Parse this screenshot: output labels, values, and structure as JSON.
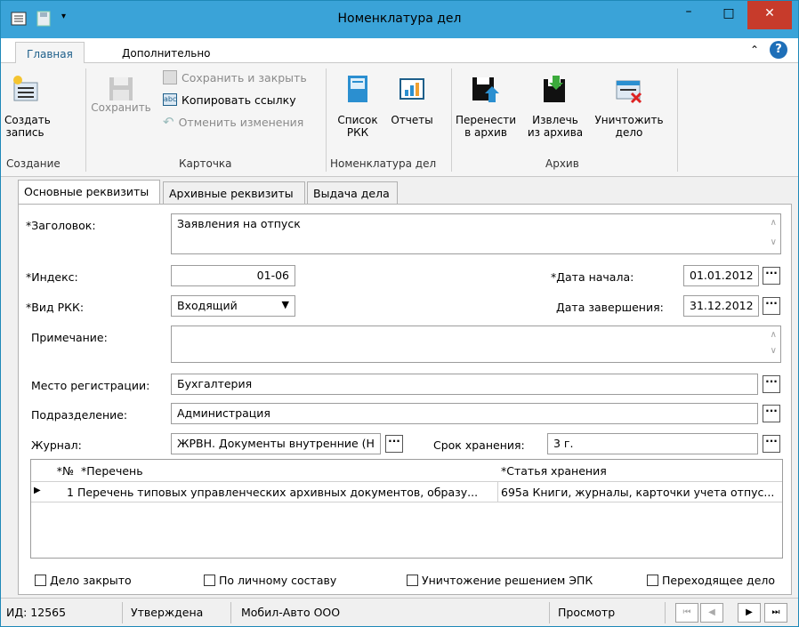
{
  "window": {
    "title": "Номенклатура дел",
    "minimize": "–",
    "maximize": "□",
    "close": "✕"
  },
  "ribbon_tabs": [
    "Главная",
    "Дополнительно"
  ],
  "ribbon": {
    "create_label1": "Создать",
    "create_label2": "запись",
    "save_label": "Сохранить",
    "save_close": "Сохранить и закрыть",
    "copy_link": "Копировать ссылку",
    "cancel_changes": "Отменить изменения",
    "rkk_list1": "Список",
    "rkk_list2": "РКК",
    "reports": "Отчеты",
    "move_archive1": "Перенести",
    "move_archive2": "в архив",
    "extract_archive1": "Извлечь",
    "extract_archive2": "из архива",
    "destroy1": "Уничтожить",
    "destroy2": "дело",
    "groups": {
      "create": "Создание",
      "card": "Карточка",
      "nomenclature": "Номенклатура дел",
      "archive": "Архив"
    }
  },
  "tabs": [
    "Основные реквизиты",
    "Архивные реквизиты",
    "Выдача дела"
  ],
  "form": {
    "title_label": "*Заголовок:",
    "title_value": "Заявления на отпуск",
    "index_label": "*Индекс:",
    "index_value": "01-06",
    "start_label": "*Дата начала:",
    "start_value": "01.01.2012",
    "rkk_type_label": "*Вид РКК:",
    "rkk_type_value": "Входящий",
    "end_label": "Дата завершения:",
    "end_value": "31.12.2012",
    "note_label": "Примечание:",
    "place_label": "Место регистрации:",
    "place_value": "Бухгалтерия",
    "dept_label": "Подразделение:",
    "dept_value": "Администрация",
    "journal_label": "Журнал:",
    "journal_value": "ЖРВН. Документы внутренние (Н",
    "retention_label": "Срок хранения:",
    "retention_value": "3 г."
  },
  "grid": {
    "headers": [
      "*№",
      "*Перечень",
      "*Статья хранения"
    ],
    "rows": [
      {
        "num": "1",
        "list": "Перечень типовых управленческих архивных документов, образу...",
        "article": "695а Книги, журналы, карточки учета отпус..."
      }
    ]
  },
  "checkboxes": [
    "Дело закрыто",
    "По личному составу",
    "Уничтожение решением ЭПК",
    "Переходящее дело"
  ],
  "status": {
    "id": "ИД: 12565",
    "state": "Утверждена",
    "org": "Мобил-Авто ООО",
    "mode": "Просмотр"
  },
  "colors": {
    "titlebar": "#3aa3d8",
    "close": "#c73b2b",
    "accent": "#1e5f8a"
  }
}
